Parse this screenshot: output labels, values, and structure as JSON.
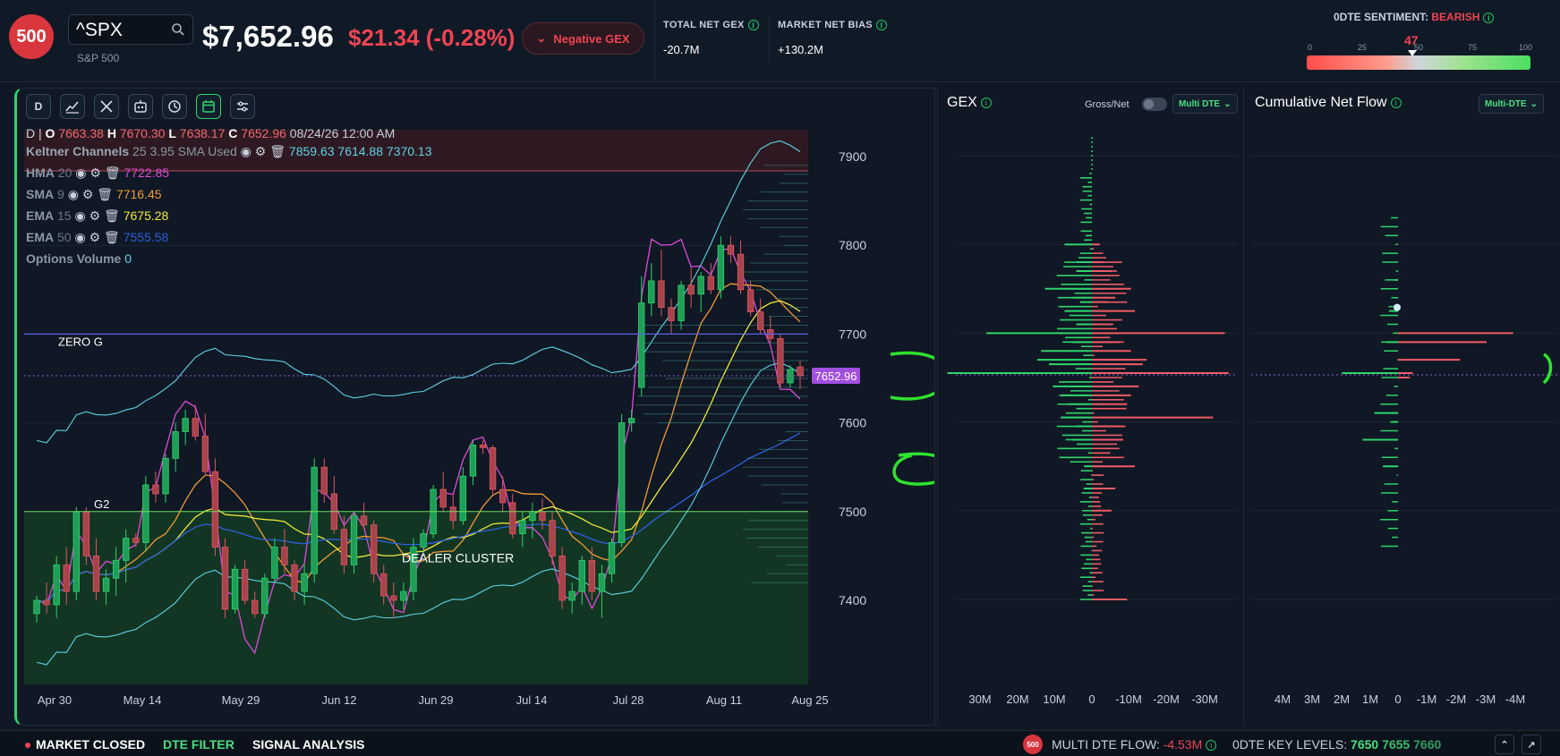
{
  "header": {
    "logo": "500",
    "symbol": "^SPX",
    "name": "S&P 500",
    "price": "$7,652.96",
    "change": "$21.34 (-0.28%)",
    "gex_button": "Negative GEX",
    "stats": [
      {
        "label": "TOTAL NET GEX",
        "value": "-20.7M"
      },
      {
        "label": "MARKET NET BIAS",
        "value": "+130.2M"
      }
    ],
    "sentiment": {
      "label": "0DTE SENTIMENT:",
      "value": "BEARISH",
      "score": "47",
      "ticks": [
        "0",
        "25",
        "50",
        "75",
        "100"
      ],
      "level": 47
    }
  },
  "toolbar": {
    "interval": "D",
    "tools": [
      "chart-type-icon",
      "drawing-tools-icon",
      "bot-icon",
      "history-icon",
      "calendar-icon",
      "settings-sliders-icon"
    ]
  },
  "legend": {
    "ohlc_prefix": "D |",
    "o_label": "O",
    "o": "7663.38",
    "h_label": "H",
    "h": "7670.30",
    "l_label": "L",
    "l": "7638.17",
    "c_label": "C",
    "c": "7652.96",
    "datetime": "08/24/26 12:00 AM",
    "keltner": {
      "name": "Keltner Channels",
      "params": "25 3.95 SMA Used",
      "values": "7859.63 7614.88 7370.13"
    },
    "hma": {
      "name": "HMA",
      "param": "20",
      "value": "7722.85"
    },
    "sma": {
      "name": "SMA",
      "param": "9",
      "value": "7716.45"
    },
    "ema15": {
      "name": "EMA",
      "param": "15",
      "value": "7675.28"
    },
    "ema50": {
      "name": "EMA",
      "param": "50",
      "value": "7555.58"
    },
    "optvol": {
      "name": "Options Volume",
      "value": "0"
    }
  },
  "levels": {
    "zero_g": "ZERO G",
    "g2": "G2",
    "dealer_cluster": "DEALER CLUSTER",
    "price_tag": "7652.96"
  },
  "chart_data": [
    {
      "type": "candlestick",
      "x_ticks": [
        "Apr 30",
        "May 14",
        "May 29",
        "Jun 12",
        "Jun 29",
        "Jul 14",
        "Jul 28",
        "Aug 11",
        "Aug 25"
      ],
      "y_ticks": [
        "7900",
        "7800",
        "7700",
        "7600",
        "7500",
        "7400"
      ],
      "ylim": [
        7380,
        7940
      ],
      "candles": [
        {
          "o": 7385,
          "h": 7405,
          "l": 7375,
          "c": 7400
        },
        {
          "o": 7400,
          "h": 7420,
          "l": 7385,
          "c": 7395
        },
        {
          "o": 7395,
          "h": 7450,
          "l": 7380,
          "c": 7440
        },
        {
          "o": 7440,
          "h": 7460,
          "l": 7395,
          "c": 7410
        },
        {
          "o": 7410,
          "h": 7505,
          "l": 7400,
          "c": 7500
        },
        {
          "o": 7500,
          "h": 7505,
          "l": 7440,
          "c": 7450
        },
        {
          "o": 7450,
          "h": 7470,
          "l": 7400,
          "c": 7410
        },
        {
          "o": 7410,
          "h": 7435,
          "l": 7395,
          "c": 7425
        },
        {
          "o": 7425,
          "h": 7460,
          "l": 7405,
          "c": 7445
        },
        {
          "o": 7445,
          "h": 7480,
          "l": 7420,
          "c": 7470
        },
        {
          "o": 7470,
          "h": 7475,
          "l": 7460,
          "c": 7465
        },
        {
          "o": 7465,
          "h": 7540,
          "l": 7455,
          "c": 7530
        },
        {
          "o": 7530,
          "h": 7545,
          "l": 7510,
          "c": 7520
        },
        {
          "o": 7520,
          "h": 7565,
          "l": 7510,
          "c": 7560
        },
        {
          "o": 7560,
          "h": 7600,
          "l": 7545,
          "c": 7590
        },
        {
          "o": 7590,
          "h": 7615,
          "l": 7575,
          "c": 7605
        },
        {
          "o": 7605,
          "h": 7620,
          "l": 7580,
          "c": 7585
        },
        {
          "o": 7585,
          "h": 7610,
          "l": 7540,
          "c": 7545
        },
        {
          "o": 7545,
          "h": 7560,
          "l": 7450,
          "c": 7460
        },
        {
          "o": 7460,
          "h": 7470,
          "l": 7380,
          "c": 7390
        },
        {
          "o": 7390,
          "h": 7440,
          "l": 7385,
          "c": 7435
        },
        {
          "o": 7435,
          "h": 7445,
          "l": 7395,
          "c": 7400
        },
        {
          "o": 7400,
          "h": 7410,
          "l": 7380,
          "c": 7385
        },
        {
          "o": 7385,
          "h": 7430,
          "l": 7380,
          "c": 7425
        },
        {
          "o": 7425,
          "h": 7470,
          "l": 7420,
          "c": 7460
        },
        {
          "o": 7460,
          "h": 7480,
          "l": 7430,
          "c": 7440
        },
        {
          "o": 7440,
          "h": 7445,
          "l": 7400,
          "c": 7410
        },
        {
          "o": 7410,
          "h": 7440,
          "l": 7395,
          "c": 7430
        },
        {
          "o": 7430,
          "h": 7560,
          "l": 7420,
          "c": 7550
        },
        {
          "o": 7550,
          "h": 7560,
          "l": 7510,
          "c": 7520
        },
        {
          "o": 7520,
          "h": 7540,
          "l": 7475,
          "c": 7480
        },
        {
          "o": 7480,
          "h": 7495,
          "l": 7430,
          "c": 7440
        },
        {
          "o": 7440,
          "h": 7500,
          "l": 7430,
          "c": 7495
        },
        {
          "o": 7495,
          "h": 7510,
          "l": 7480,
          "c": 7485
        },
        {
          "o": 7485,
          "h": 7490,
          "l": 7420,
          "c": 7430
        },
        {
          "o": 7430,
          "h": 7440,
          "l": 7395,
          "c": 7405
        },
        {
          "o": 7405,
          "h": 7420,
          "l": 7380,
          "c": 7400
        },
        {
          "o": 7400,
          "h": 7420,
          "l": 7390,
          "c": 7410
        },
        {
          "o": 7410,
          "h": 7470,
          "l": 7400,
          "c": 7460
        },
        {
          "o": 7460,
          "h": 7480,
          "l": 7450,
          "c": 7475
        },
        {
          "o": 7475,
          "h": 7530,
          "l": 7470,
          "c": 7525
        },
        {
          "o": 7525,
          "h": 7545,
          "l": 7500,
          "c": 7505
        },
        {
          "o": 7505,
          "h": 7520,
          "l": 7480,
          "c": 7490
        },
        {
          "o": 7490,
          "h": 7550,
          "l": 7485,
          "c": 7540
        },
        {
          "o": 7540,
          "h": 7580,
          "l": 7530,
          "c": 7575
        },
        {
          "o": 7575,
          "h": 7580,
          "l": 7565,
          "c": 7572
        },
        {
          "o": 7572,
          "h": 7575,
          "l": 7520,
          "c": 7525
        },
        {
          "o": 7525,
          "h": 7540,
          "l": 7500,
          "c": 7510
        },
        {
          "o": 7510,
          "h": 7520,
          "l": 7470,
          "c": 7475
        },
        {
          "o": 7475,
          "h": 7500,
          "l": 7460,
          "c": 7490
        },
        {
          "o": 7490,
          "h": 7510,
          "l": 7470,
          "c": 7500
        },
        {
          "o": 7500,
          "h": 7515,
          "l": 7480,
          "c": 7490
        },
        {
          "o": 7490,
          "h": 7500,
          "l": 7440,
          "c": 7450
        },
        {
          "o": 7450,
          "h": 7460,
          "l": 7390,
          "c": 7400
        },
        {
          "o": 7400,
          "h": 7420,
          "l": 7385,
          "c": 7410
        },
        {
          "o": 7410,
          "h": 7450,
          "l": 7395,
          "c": 7445
        },
        {
          "o": 7445,
          "h": 7460,
          "l": 7400,
          "c": 7410
        },
        {
          "o": 7410,
          "h": 7440,
          "l": 7380,
          "c": 7430
        },
        {
          "o": 7430,
          "h": 7470,
          "l": 7420,
          "c": 7465
        },
        {
          "o": 7465,
          "h": 7610,
          "l": 7460,
          "c": 7600
        },
        {
          "o": 7600,
          "h": 7615,
          "l": 7590,
          "c": 7605
        },
        {
          "o": 7640,
          "h": 7765,
          "l": 7630,
          "c": 7735
        },
        {
          "o": 7735,
          "h": 7780,
          "l": 7720,
          "c": 7760
        },
        {
          "o": 7760,
          "h": 7795,
          "l": 7720,
          "c": 7730
        },
        {
          "o": 7730,
          "h": 7740,
          "l": 7700,
          "c": 7715
        },
        {
          "o": 7715,
          "h": 7760,
          "l": 7705,
          "c": 7755
        },
        {
          "o": 7755,
          "h": 7775,
          "l": 7730,
          "c": 7745
        },
        {
          "o": 7745,
          "h": 7770,
          "l": 7725,
          "c": 7765
        },
        {
          "o": 7765,
          "h": 7780,
          "l": 7745,
          "c": 7750
        },
        {
          "o": 7750,
          "h": 7810,
          "l": 7740,
          "c": 7800
        },
        {
          "o": 7800,
          "h": 7810,
          "l": 7780,
          "c": 7790
        },
        {
          "o": 7790,
          "h": 7805,
          "l": 7745,
          "c": 7750
        },
        {
          "o": 7750,
          "h": 7760,
          "l": 7720,
          "c": 7725
        },
        {
          "o": 7725,
          "h": 7740,
          "l": 7700,
          "c": 7705
        },
        {
          "o": 7705,
          "h": 7720,
          "l": 7690,
          "c": 7695
        },
        {
          "o": 7695,
          "h": 7700,
          "l": 7640,
          "c": 7645
        },
        {
          "o": 7645,
          "h": 7665,
          "l": 7640,
          "c": 7660
        },
        {
          "o": 7663,
          "h": 7670,
          "l": 7638,
          "c": 7653
        }
      ],
      "zero_g": 7700,
      "g2": 7500,
      "current_price": 7653
    },
    {
      "type": "horizontal-bar",
      "title": "GEX",
      "x_ticks": [
        "30M",
        "20M",
        "10M",
        "0",
        "-10M",
        "-20M",
        "-30M"
      ],
      "y_ticks": [
        "7900",
        "7800",
        "7700",
        "7600",
        "7500",
        "7400"
      ],
      "rows": [
        {
          "strike": 7700,
          "pos": 27,
          "neg": -34
        },
        {
          "strike": 7655,
          "pos": 37,
          "neg": -35
        },
        {
          "strike": 7605,
          "pos": 8,
          "neg": -31
        },
        {
          "strike": 7750,
          "pos": 12,
          "neg": -10
        },
        {
          "strike": 7725,
          "pos": 7,
          "neg": -11
        },
        {
          "strike": 7690,
          "pos": 5,
          "neg": -7
        },
        {
          "strike": 7680,
          "pos": 13,
          "neg": -10
        },
        {
          "strike": 7670,
          "pos": 14,
          "neg": -14
        },
        {
          "strike": 7665,
          "pos": 11,
          "neg": -13
        },
        {
          "strike": 7640,
          "pos": 10,
          "neg": -12
        },
        {
          "strike": 7630,
          "pos": 8,
          "neg": -10
        },
        {
          "strike": 7620,
          "pos": 6,
          "neg": -9
        },
        {
          "strike": 7595,
          "pos": 4,
          "neg": -8
        },
        {
          "strike": 7580,
          "pos": 5,
          "neg": -8
        },
        {
          "strike": 7550,
          "pos": 2,
          "neg": -11
        },
        {
          "strike": 7800,
          "pos": 7,
          "neg": -2
        },
        {
          "strike": 7780,
          "pos": 4,
          "neg": -3
        },
        {
          "strike": 7770,
          "pos": 4,
          "neg": -5
        },
        {
          "strike": 7740,
          "pos": 5,
          "neg": -6
        },
        {
          "strike": 7735,
          "pos": 3,
          "neg": -4
        },
        {
          "strike": 7710,
          "pos": 4,
          "neg": -5
        },
        {
          "strike": 7400,
          "pos": 0,
          "neg": -9
        },
        {
          "strike": 7500,
          "pos": 0,
          "neg": -5
        },
        {
          "strike": 7525,
          "pos": 2,
          "neg": -6
        }
      ]
    },
    {
      "type": "horizontal-bar",
      "title": "Cumulative Net Flow",
      "x_ticks": [
        "4M",
        "3M",
        "2M",
        "1M",
        "0",
        "-1M",
        "-2M",
        "-3M",
        "-4M"
      ],
      "rows": [
        {
          "strike": 7700,
          "pos": 0,
          "neg": -3.9
        },
        {
          "strike": 7690,
          "pos": 0,
          "neg": -3.0
        },
        {
          "strike": 7670,
          "pos": 0,
          "neg": -2.1
        },
        {
          "strike": 7655,
          "pos": 1.9,
          "neg": -0.5
        },
        {
          "strike": 7650,
          "pos": 0,
          "neg": -0.4
        },
        {
          "strike": 7690,
          "pos": 0.4,
          "neg": 0
        },
        {
          "strike": 7610,
          "pos": 0.8,
          "neg": 0
        },
        {
          "strike": 7580,
          "pos": 1.2,
          "neg": 0
        },
        {
          "strike": 7550,
          "pos": 0.5,
          "neg": 0
        },
        {
          "strike": 7725,
          "pos": 0.3,
          "neg": 0
        },
        {
          "strike": 7760,
          "pos": 0.1,
          "neg": 0
        },
        {
          "strike": 7600,
          "pos": 0.2,
          "neg": 0
        }
      ]
    }
  ],
  "gex_panel": {
    "title": "GEX",
    "toggle_label": "Gross/Net",
    "dte_select": "Multi DTE"
  },
  "flow_panel": {
    "title": "Cumulative Net Flow",
    "dte_select": "Multi-DTE"
  },
  "footer": {
    "market_status": "MARKET CLOSED",
    "dte_filter": "DTE FILTER",
    "signal_analysis": "SIGNAL ANALYSIS",
    "multi_dte_label": "MULTI DTE FLOW:",
    "multi_dte_value": "-4.53M",
    "key_levels_label": "0DTE KEY LEVELS:",
    "key_levels": [
      "7650",
      "7655",
      "7660"
    ],
    "mini_logo": "500"
  },
  "colors": {
    "up": "#2fd36b",
    "down": "#e0565f",
    "accent": "#22c55e",
    "bearish": "#ef4452"
  }
}
